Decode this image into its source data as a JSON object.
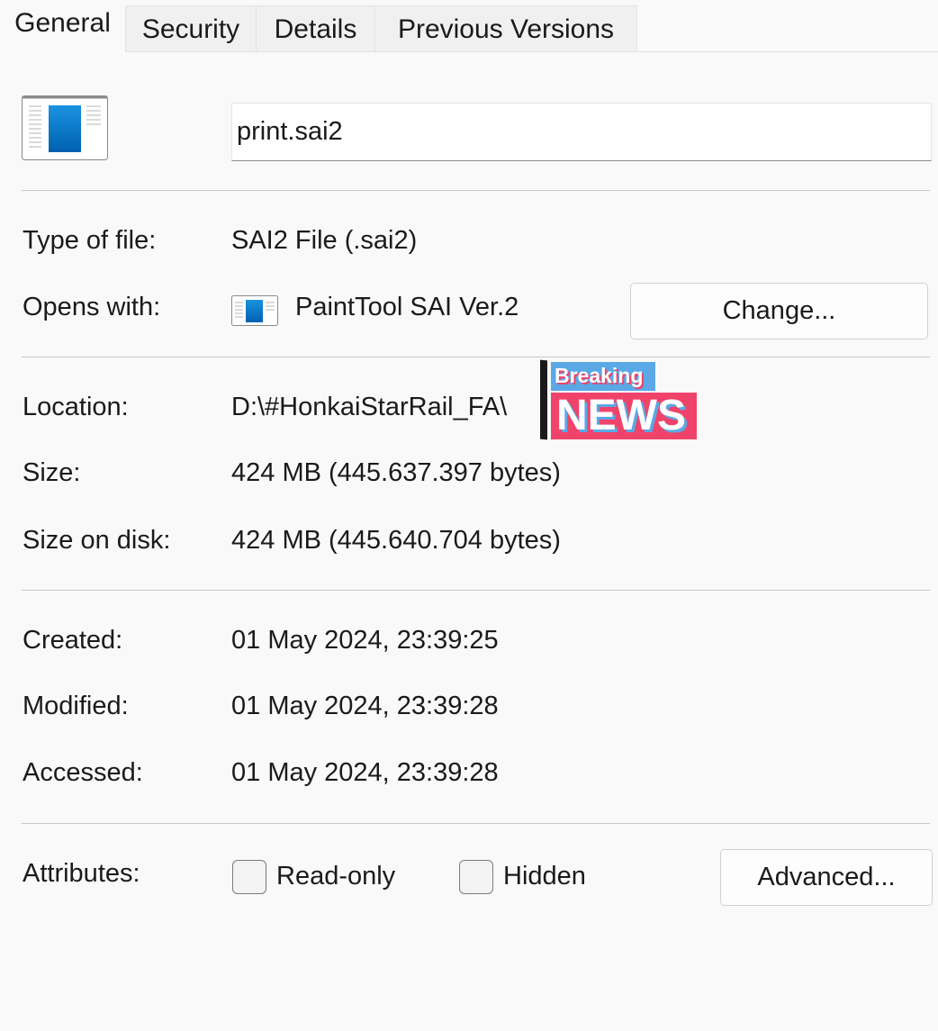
{
  "tabs": [
    {
      "label": "General",
      "active": true
    },
    {
      "label": "Security"
    },
    {
      "label": "Details"
    },
    {
      "label": "Previous Versions"
    }
  ],
  "file": {
    "name": "print.sai2",
    "icon": "sai2-file-icon"
  },
  "type_of_file": {
    "label": "Type of file:",
    "value": "SAI2 File (.sai2)"
  },
  "opens_with": {
    "label": "Opens with:",
    "value": "PaintTool SAI Ver.2",
    "icon": "painttool-sai-icon",
    "change_label": "Change..."
  },
  "location": {
    "label": "Location:",
    "value": "D:\\#HonkaiStarRail_FA\\"
  },
  "size": {
    "label": "Size:",
    "value": "424 MB (445.637.397 bytes)"
  },
  "size_on_disk": {
    "label": "Size on disk:",
    "value": "424 MB (445.640.704 bytes)"
  },
  "created": {
    "label": "Created:",
    "value": "01 May 2024, 23:39:25"
  },
  "modified": {
    "label": "Modified:",
    "value": "01 May 2024, 23:39:28"
  },
  "accessed": {
    "label": "Accessed:",
    "value": "01 May 2024, 23:39:28"
  },
  "attributes": {
    "label": "Attributes:",
    "readonly_label": "Read-only",
    "readonly_checked": false,
    "hidden_label": "Hidden",
    "hidden_checked": false,
    "advanced_label": "Advanced..."
  },
  "sticker": {
    "top": "Breaking",
    "bottom": "NEWS",
    "top_color": "#5aa8e6",
    "bottom_color": "#f0436a"
  }
}
